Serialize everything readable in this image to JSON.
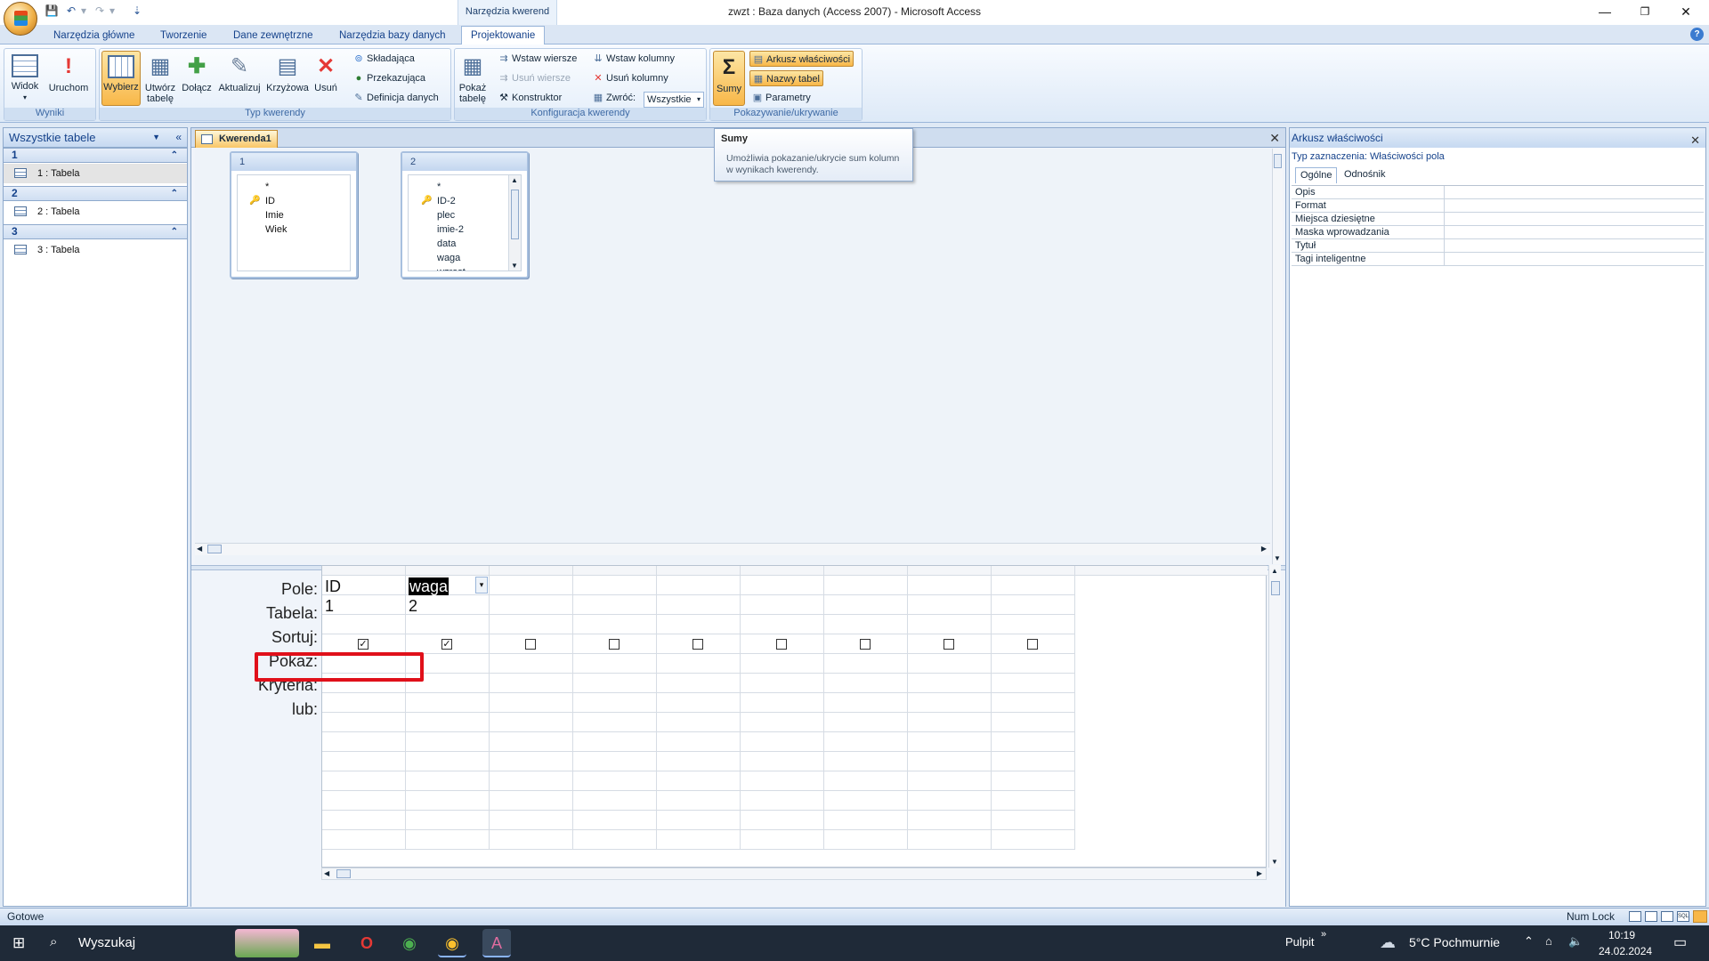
{
  "window": {
    "title": "zwzt : Baza danych (Access 2007) - Microsoft Access",
    "contextual_tab": "Narzędzia kwerend"
  },
  "ribbon_tabs": [
    "Narzędzia główne",
    "Tworzenie",
    "Dane zewnętrzne",
    "Narzędzia bazy danych",
    "Projektowanie"
  ],
  "ribbon": {
    "groups": {
      "results": "Wyniki",
      "query_type": "Typ kwerendy",
      "query_config": "Konfiguracja kwerendy",
      "show_hide": "Pokazywanie/ukrywanie"
    },
    "buttons": {
      "view": "Widok",
      "run": "Uruchom",
      "select": "Wybierz",
      "make_table_1": "Utwórz",
      "make_table_2": "tabelę",
      "append": "Dołącz",
      "update": "Aktualizuj",
      "crosstab": "Krzyżowa",
      "delete": "Usuń",
      "union": "Składająca",
      "pass_through": "Przekazująca",
      "data_definition": "Definicja danych",
      "show_table_1": "Pokaż",
      "show_table_2": "tabelę",
      "insert_rows": "Wstaw wiersze",
      "delete_rows": "Usuń wiersze",
      "builder": "Konstruktor",
      "insert_columns": "Wstaw kolumny",
      "delete_columns": "Usuń kolumny",
      "return": "Zwróć:",
      "return_value": "Wszystkie",
      "totals": "Sumy",
      "property_sheet": "Arkusz właściwości",
      "table_names": "Nazwy tabel",
      "parameters": "Parametry"
    }
  },
  "tooltip": {
    "title": "Sumy",
    "body": "Umożliwia pokazanie/ukrycie sum kolumn w wynikach kwerendy."
  },
  "nav_pane": {
    "header": "Wszystkie tabele",
    "groups": [
      {
        "name": "1",
        "item": "1 : Tabela"
      },
      {
        "name": "2",
        "item": "2 : Tabela"
      },
      {
        "name": "3",
        "item": "3 : Tabela"
      }
    ]
  },
  "document": {
    "tab": "Kwerenda1",
    "tables": [
      {
        "name": "1",
        "fields": [
          "*",
          "ID",
          "Imie",
          "Wiek"
        ]
      },
      {
        "name": "2",
        "fields": [
          "*",
          "ID-2",
          "plec",
          "imie-2",
          "data",
          "waga",
          "wzrost"
        ]
      }
    ]
  },
  "grid": {
    "row_labels": [
      "Pole:",
      "Tabela:",
      "Sortuj:",
      "Pokaż:",
      "Kryteria:",
      "lub:"
    ],
    "columns": [
      {
        "field": "ID",
        "table": "1",
        "show": true
      },
      {
        "field": "waga",
        "table": "2",
        "show": true
      },
      {
        "field": "",
        "table": "",
        "show": false
      },
      {
        "field": "",
        "table": "",
        "show": false
      },
      {
        "field": "",
        "table": "",
        "show": false
      },
      {
        "field": "",
        "table": "",
        "show": false
      },
      {
        "field": "",
        "table": "",
        "show": false
      },
      {
        "field": "",
        "table": "",
        "show": false
      },
      {
        "field": "",
        "table": "",
        "show": false
      }
    ]
  },
  "properties": {
    "title": "Arkusz właściwości",
    "selection_type": "Typ zaznaczenia:  Właściwości pola",
    "tabs": [
      "Ogólne",
      "Odnośnik"
    ],
    "rows": [
      "Opis",
      "Format",
      "Miejsca dziesiętne",
      "Maska wprowadzania",
      "Tytuł",
      "Tagi inteligentne"
    ]
  },
  "status": {
    "left": "Gotowe",
    "num_lock": "Num Lock"
  },
  "taskbar": {
    "search": "Wyszukaj",
    "desktop": "Pulpit",
    "weather": "5°C  Pochmurnie",
    "time": "10:19",
    "date": "24.02.2024"
  },
  "colors": {
    "accent": "#15428b",
    "selected_button": "#f8b748",
    "highlight_box": "#e0101a"
  }
}
